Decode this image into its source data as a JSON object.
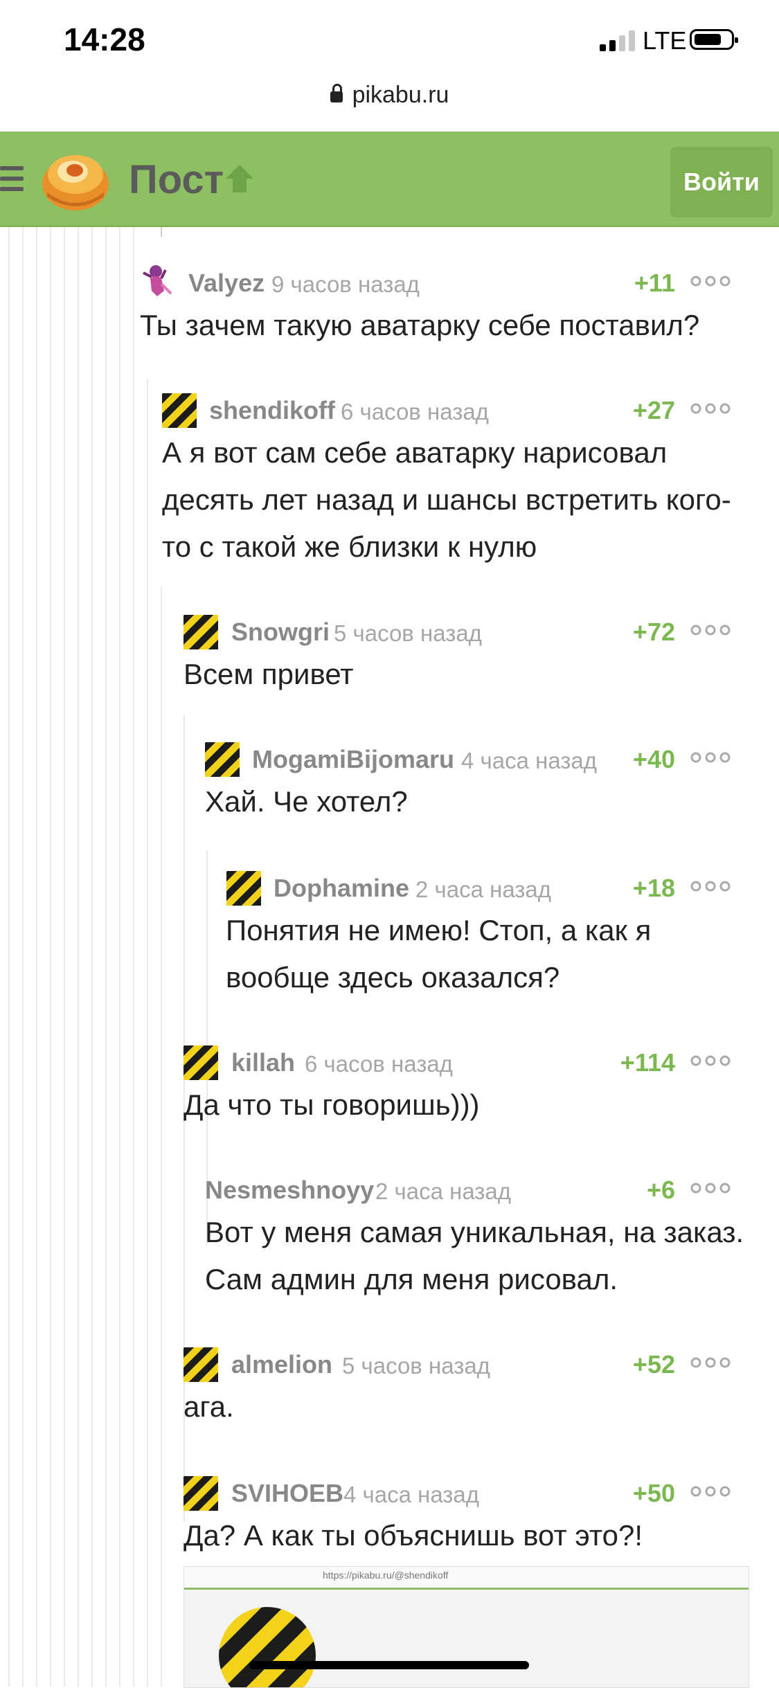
{
  "status_bar": {
    "time": "14:28",
    "network": "LTE"
  },
  "browser": {
    "url": "pikabu.ru"
  },
  "header": {
    "title": "Пост",
    "login_label": "Войти"
  },
  "comments": [
    {
      "author": "Valyez",
      "time": "9 часов назад",
      "rating": "+11",
      "text": "Ты зачем такую аватарку себе поставил?"
    },
    {
      "author": "shendikoff",
      "time": "6 часов назад",
      "rating": "+27",
      "text": "А я вот сам себе аватарку нарисовал десять лет назад и шансы встретить кого-то с такой же близки к нулю"
    },
    {
      "author": "Snowgri",
      "time": "5 часов назад",
      "rating": "+72",
      "text": "Всем привет"
    },
    {
      "author": "MogamiBijomaru",
      "time": "4 часа назад",
      "rating": "+40",
      "text": "Хай. Че хотел?"
    },
    {
      "author": "Dophamine",
      "time": "2 часа назад",
      "rating": "+18",
      "text": "Понятия не имею! Стоп, а как я вообще здесь оказался?"
    },
    {
      "author": "killah",
      "time": "6 часов назад",
      "rating": "+114",
      "text": "Да что ты говоришь)))"
    },
    {
      "author": "Nesmeshnoyy",
      "time": "2 часа назад",
      "rating": "+6",
      "text": "Вот у меня самая уникальная, на заказ. Сам админ для меня рисовал."
    },
    {
      "author": "almelion",
      "time": "5 часов назад",
      "rating": "+52",
      "text": "ага."
    },
    {
      "author": "SVIHOEB",
      "time": "4 часа назад",
      "rating": "+50",
      "text": "Да? А как ты объяснишь вот это?!"
    }
  ],
  "embed": {
    "url": "https://pikabu.ru/@shendikoff"
  }
}
